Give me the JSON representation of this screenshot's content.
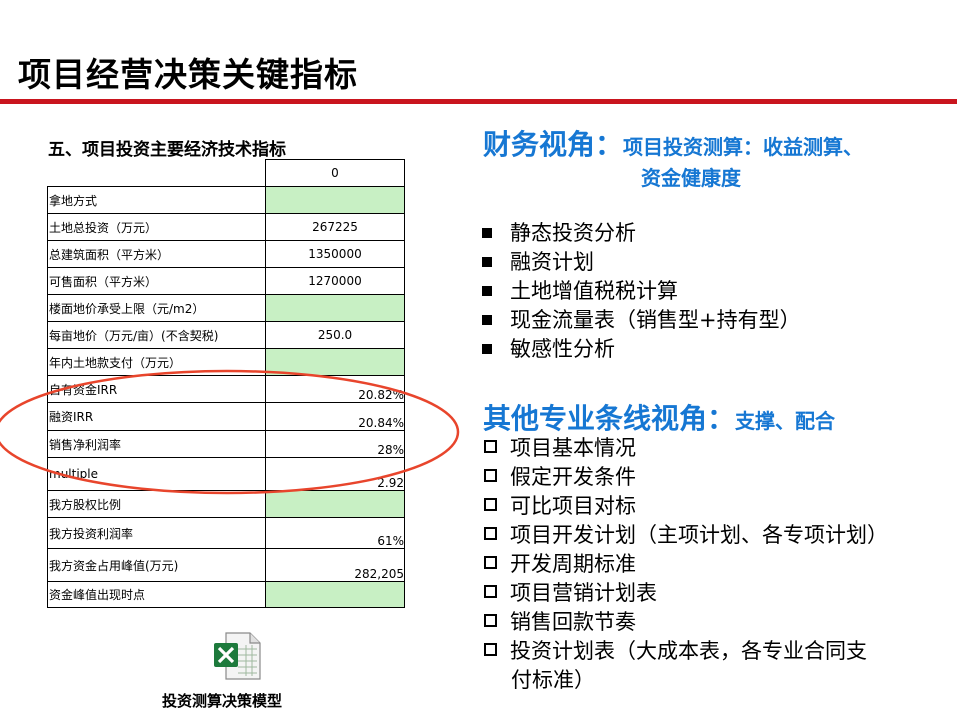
{
  "title": "项目经营决策关键指标",
  "table": {
    "caption": "五、项目投资主要经济技术指标",
    "header_value": "0",
    "rows": [
      {
        "label": "拿地方式",
        "value": "",
        "green": true
      },
      {
        "label": "土地总投资（万元）",
        "value": "267225",
        "green": false
      },
      {
        "label": "总建筑面积（平方米）",
        "value": "1350000",
        "green": false
      },
      {
        "label": "可售面积（平方米）",
        "value": "1270000",
        "green": false
      },
      {
        "label": "楼面地价承受上限（元/m2）",
        "value": "",
        "green": true
      },
      {
        "label": "每亩地价（万元/亩）(不含契税)",
        "value": "250.0",
        "green": false
      },
      {
        "label": "年内土地款支付（万元）",
        "value": "",
        "green": true
      },
      {
        "label": "自有资金IRR",
        "value": "20.82%",
        "green": false
      },
      {
        "label": "融资IRR",
        "value": "20.84%",
        "green": false
      },
      {
        "label": "销售净利润率",
        "value": "28%",
        "green": false
      },
      {
        "label": "multiple",
        "value": "2.92",
        "green": false
      },
      {
        "label": "我方股权比例",
        "value": "",
        "green": true
      },
      {
        "label": "我方投资利润率",
        "value": "61%",
        "green": false
      },
      {
        "label": "我方资金占用峰值(万元)",
        "value": "282,205",
        "green": false
      },
      {
        "label": "资金峰值出现时点",
        "value": "",
        "green": true
      }
    ]
  },
  "file": {
    "icon": "excel-file-icon",
    "caption": "投资测算决策模型"
  },
  "finance": {
    "heading": "财务视角：",
    "sub_line1": "项目投资测算：收益测算、",
    "sub_line2": "资金健康度",
    "items": [
      "静态投资分析",
      "融资计划",
      "土地增值税税计算",
      "现金流量表（销售型+持有型）",
      "敏感性分析"
    ]
  },
  "other": {
    "heading": "其他专业条线视角：",
    "sub": "支撑、配合",
    "items": [
      "项目基本情况",
      "假定开发条件",
      "可比项目对标",
      "项目开发计划（主项计划、各专项计划）",
      "开发周期标准",
      "项目营销计划表",
      "销售回款节奏"
    ],
    "last_item_line1": "投资计划表（大成本表，各专业合同支",
    "last_item_line2": "付标准）"
  },
  "colors": {
    "accent": "#c9151e",
    "heading_blue": "#1677d3",
    "cell_green": "#c8f0c4",
    "oval_red": "#e8452c"
  }
}
